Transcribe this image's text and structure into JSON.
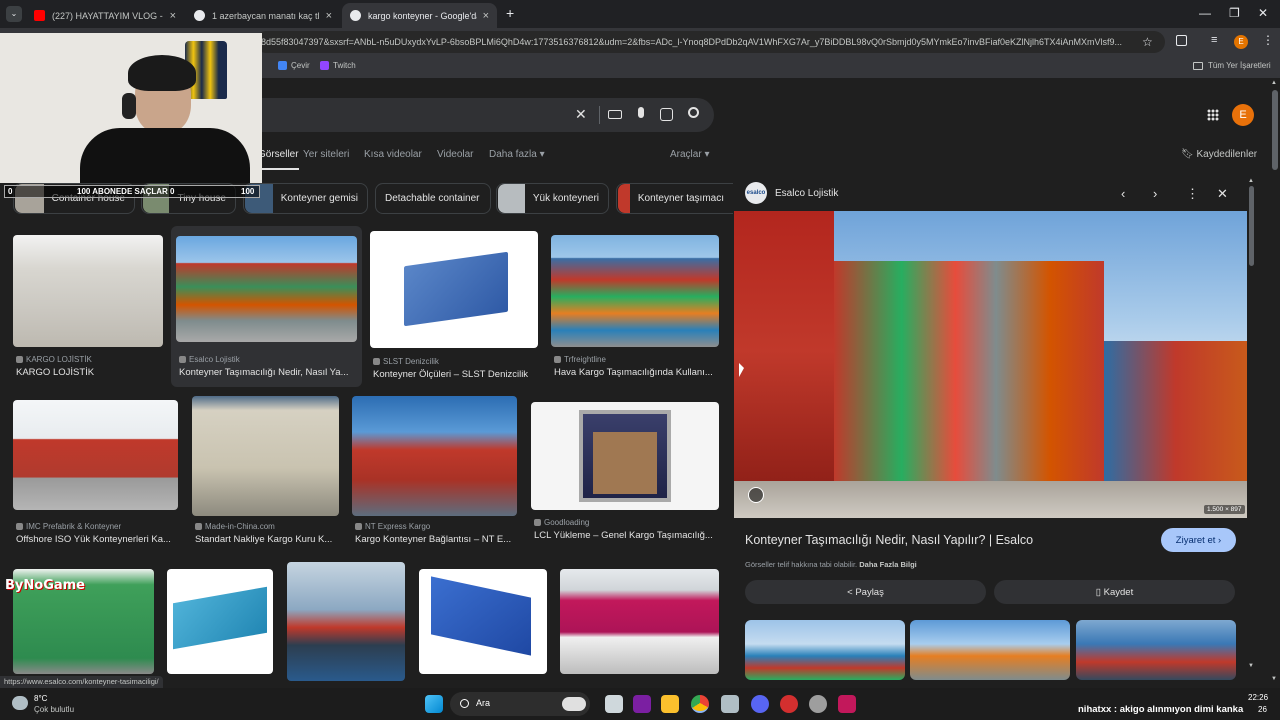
{
  "tabs": [
    {
      "title": "(227) HAYATTAYIM VLOG - YouT",
      "color": "#ff0000"
    },
    {
      "title": "1 azerbaycan manatı kaç tl - Go",
      "color": "#4285f4"
    },
    {
      "title": "kargo konteyner - Google'da A",
      "color": "#4285f4"
    }
  ],
  "address": {
    "url": "8d55f83047397&sxsrf=ANbL-n5uDUxydxYvLP-6bsoBPLMi6QhD4w:1773516376812&udm=2&fbs=ADc_l-Ynoq8DPdDb2qAV1WhFXG7Ar_y7BiDDBL98vQ0rSbmjd0y5MYmkEo7invBFiaf0eKZlNjlh6TX4iAnMXmVlsf9..."
  },
  "bookmarks": {
    "items": [
      "Çevir",
      "Twitch"
    ],
    "all_label": "Tüm Yer İşaretleri"
  },
  "search": {
    "tabs": [
      "Görseller",
      "Yer siteleri",
      "Kısa videolar",
      "Videolar",
      "Daha fazla"
    ],
    "tools": "Araçlar",
    "saved": "Kaydedilenler",
    "avatar": "E"
  },
  "chips": [
    "Container house",
    "Tiny house",
    "Konteyner gemisi",
    "Detachable container",
    "Yük konteyneri",
    "Konteyner taşımacı"
  ],
  "results": [
    {
      "source": "KARGO LOJİSTİK",
      "caption": "KARGO LOJİSTİK"
    },
    {
      "source": "Esalco Lojistik",
      "caption": "Konteyner Taşımacılığı Nedir, Nasıl Ya..."
    },
    {
      "source": "SLST Denizcilik",
      "caption": "Konteyner Ölçüleri – SLST Denizcilik"
    },
    {
      "source": "Trfreightline",
      "caption": "Hava Kargo Taşımacılığında Kullanı..."
    },
    {
      "source": "IMC Prefabrik & Konteyner",
      "caption": "Offshore ISO Yük Konteynerleri Ka..."
    },
    {
      "source": "Made-in-China.com",
      "caption": "Standart Nakliye Kargo Kuru K..."
    },
    {
      "source": "NT Express Kargo",
      "caption": "Kargo Konteyner Bağlantısı – NT E..."
    },
    {
      "source": "Goodloading",
      "caption": "LCL Yükleme – Genel Kargo Taşımacılığ..."
    }
  ],
  "panel": {
    "site": "Esalco Lojistik",
    "logo_text": "esalco",
    "title": "Konteyner Taşımacılığı Nedir, Nasıl Yapılır? | Esalco",
    "visit": "Ziyaret et",
    "copyright": "Görseller telif hakkına tabi olabilir.",
    "more_info": "Daha Fazla Bilgi",
    "share": "Paylaş",
    "save": "Kaydet",
    "dims": "1.500 × 897"
  },
  "status_url": "https://www.esalco.com/konteyner-tasimaciligi/",
  "overlay": {
    "sub_left": "0",
    "sub_text": "100 ABONEDE SAÇLAR 0",
    "sub_right": "100",
    "logo": "ByNoGame"
  },
  "taskbar": {
    "weather_temp": "8°C",
    "weather_desc": "Çok bulutlu",
    "search": "Ara",
    "time": "22:26",
    "date": "26"
  },
  "chat": "nihatxx : akigo alınmıyon dimi kanka"
}
